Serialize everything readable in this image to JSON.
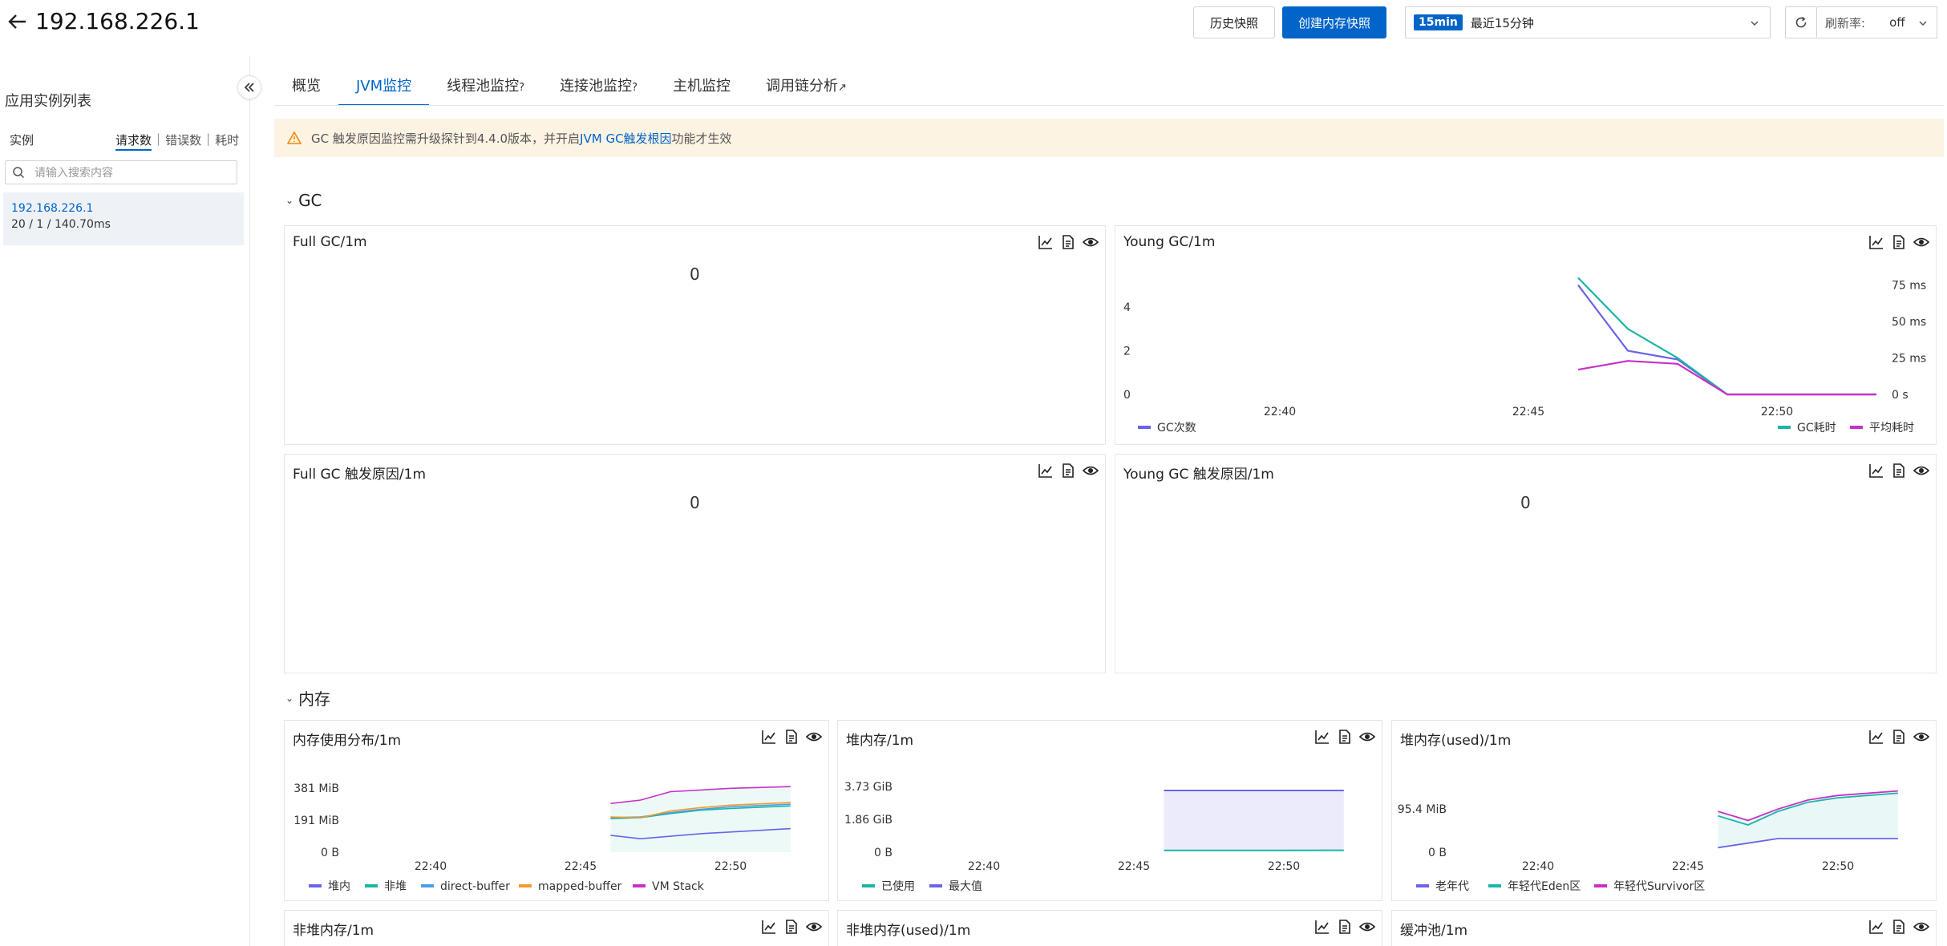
{
  "header": {
    "title": "192.168.226.1",
    "history_btn": "历史快照",
    "create_btn": "创建内存快照",
    "time_badge": "15min",
    "time_label": "最近15分钟",
    "refresh_label": "刷新率:",
    "refresh_value": "off"
  },
  "sidebar": {
    "title": "应用实例列表",
    "col_instance": "实例",
    "metric_tabs": [
      "请求数",
      "错误数",
      "耗时"
    ],
    "search_placeholder": "请输入搜索内容",
    "instance": {
      "ip": "192.168.226.1",
      "stats": "20 / 1 / 140.70ms"
    }
  },
  "tabs": [
    {
      "label": "概览",
      "active": false
    },
    {
      "label": "JVM监控",
      "active": true
    },
    {
      "label": "线程池监控",
      "suffix": "?",
      "active": false
    },
    {
      "label": "连接池监控",
      "suffix": "?",
      "active": false
    },
    {
      "label": "主机监控",
      "active": false
    },
    {
      "label": "调用链分析",
      "suffix": "↗",
      "active": false
    }
  ],
  "notice": {
    "prefix": "GC 触发原因监控需升级探针到4.4.0版本，并开启",
    "link": "JVM GC触发根因",
    "suffix": "功能才生效"
  },
  "sections": {
    "gc": "GC",
    "memory": "内存"
  },
  "cards": {
    "full_gc": {
      "title": "Full GC/1m",
      "value": "0"
    },
    "young_gc": {
      "title": "Young GC/1m"
    },
    "full_gc_cause": {
      "title": "Full GC 触发原因/1m",
      "value": "0"
    },
    "young_gc_cause": {
      "title": "Young GC 触发原因/1m",
      "value": "0"
    },
    "mem_dist": {
      "title": "内存使用分布/1m"
    },
    "heap": {
      "title": "堆内存/1m"
    },
    "heap_used": {
      "title": "堆内存(used)/1m"
    },
    "nonheap": {
      "title": "非堆内存/1m"
    },
    "nonheap_used": {
      "title": "非堆内存(used)/1m"
    },
    "buffer": {
      "title": "缓冲池/1m"
    }
  },
  "colors": {
    "accent": "#0064c8",
    "warn_bg": "#fdf3e3",
    "blue": "#6a63e8",
    "teal": "#1ab5a6",
    "magenta": "#c830c8",
    "orange": "#f59a2a",
    "lightblue": "#4a9ee8"
  },
  "chart_data": [
    {
      "type": "line",
      "name": "young_gc",
      "x_ticks": [
        "22:40",
        "22:45",
        "22:50"
      ],
      "y_left_ticks": [
        "0",
        "2",
        "4"
      ],
      "y_right_ticks": [
        "0 s",
        "25 ms",
        "50 ms",
        "75 ms"
      ],
      "x": [
        "22:46",
        "22:47",
        "22:48",
        "22:49",
        "22:50",
        "22:51",
        "22:52"
      ],
      "series": [
        {
          "name": "GC次数",
          "axis": "left",
          "values": [
            5,
            2,
            1.6,
            0,
            0,
            0,
            0
          ]
        },
        {
          "name": "GC耗时",
          "axis": "right",
          "values": [
            80,
            45,
            25,
            0,
            0,
            0,
            0
          ]
        },
        {
          "name": "平均耗时",
          "axis": "right",
          "values": [
            17,
            23,
            21,
            0,
            0,
            0,
            0
          ]
        }
      ]
    },
    {
      "type": "area",
      "name": "mem_dist",
      "x_ticks": [
        "22:40",
        "22:45",
        "22:50"
      ],
      "y_ticks": [
        "0 B",
        "191 MiB",
        "381 MiB"
      ],
      "series": [
        {
          "name": "堆内",
          "values": [
            100,
            80,
            95,
            110,
            120,
            140
          ]
        },
        {
          "name": "非堆",
          "values": [
            200,
            205,
            230,
            250,
            260,
            275
          ]
        },
        {
          "name": "direct-buffer",
          "values": [
            205,
            210,
            235,
            255,
            270,
            285
          ]
        },
        {
          "name": "mapped-buffer",
          "values": [
            210,
            205,
            245,
            265,
            280,
            295
          ]
        },
        {
          "name": "VM Stack",
          "values": [
            290,
            310,
            360,
            370,
            380,
            390
          ]
        }
      ]
    },
    {
      "type": "area",
      "name": "heap",
      "x_ticks": [
        "22:40",
        "22:45",
        "22:50"
      ],
      "y_ticks": [
        "0 B",
        "1.86 GiB",
        "3.73 GiB"
      ],
      "series": [
        {
          "name": "已使用",
          "values": [
            0.1,
            0.1,
            0.1,
            0.11
          ]
        },
        {
          "name": "最大值",
          "values": [
            3.5,
            3.5,
            3.5,
            3.5
          ]
        }
      ]
    },
    {
      "type": "area",
      "name": "heap_used",
      "x_ticks": [
        "22:40",
        "22:45",
        "22:50"
      ],
      "y_ticks": [
        "0 B",
        "95.4 MiB"
      ],
      "series": [
        {
          "name": "老年代",
          "values": [
            10,
            20,
            30,
            30,
            30,
            30
          ]
        },
        {
          "name": "年轻代Eden区",
          "values": [
            80,
            60,
            90,
            110,
            120,
            130
          ]
        },
        {
          "name": "年轻代Survivor区",
          "values": [
            90,
            70,
            95,
            115,
            125,
            135
          ]
        }
      ]
    }
  ]
}
